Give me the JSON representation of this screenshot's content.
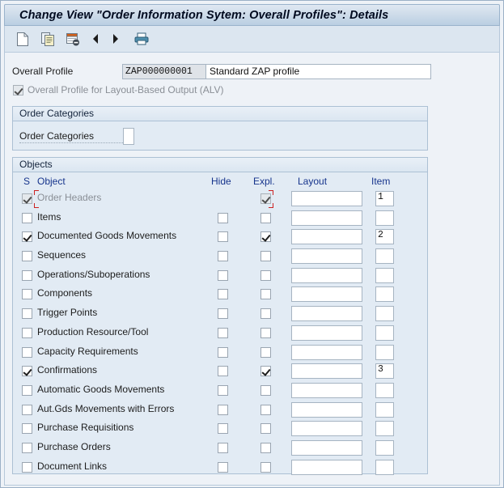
{
  "window": {
    "title": "Change View \"Order Information Sytem: Overall Profiles\": Details"
  },
  "toolbar": {
    "buttons": [
      {
        "name": "new-entries-icon",
        "title": "New Entries"
      },
      {
        "name": "copy-icon",
        "title": "Copy As..."
      },
      {
        "name": "delete-icon",
        "title": "Delete"
      },
      {
        "name": "previous-icon",
        "title": "Previous Entry"
      },
      {
        "name": "next-icon",
        "title": "Next Entry"
      },
      {
        "name": "print-icon",
        "title": "Print"
      }
    ]
  },
  "header": {
    "profile_label": "Overall Profile",
    "profile_id": "ZAP000000001",
    "profile_description": "Standard ZAP profile",
    "alv_label": "Overall Profile for Layout-Based Output (ALV)",
    "alv_checked": true,
    "alv_disabled": true
  },
  "order_categories": {
    "title": "Order Categories",
    "field_label": "Order Categories",
    "field_value": ""
  },
  "objects": {
    "title": "Objects",
    "columns": {
      "s": "S",
      "object": "Object",
      "hide": "Hide",
      "expl": "Expl.",
      "layout": "Layout",
      "item": "Item"
    },
    "rows": [
      {
        "label": "Order Headers",
        "selected": true,
        "dim": true,
        "has_hide": false,
        "hide": false,
        "expl": true,
        "layout": "",
        "item": "1",
        "focused": true
      },
      {
        "label": "Items",
        "selected": false,
        "dim": false,
        "has_hide": true,
        "hide": false,
        "expl": false,
        "layout": "",
        "item": "",
        "focused": false
      },
      {
        "label": "Documented Goods Movements",
        "selected": true,
        "dim": false,
        "has_hide": true,
        "hide": false,
        "expl": true,
        "layout": "",
        "item": "2",
        "focused": false
      },
      {
        "label": "Sequences",
        "selected": false,
        "dim": false,
        "has_hide": true,
        "hide": false,
        "expl": false,
        "layout": "",
        "item": "",
        "focused": false
      },
      {
        "label": "Operations/Suboperations",
        "selected": false,
        "dim": false,
        "has_hide": true,
        "hide": false,
        "expl": false,
        "layout": "",
        "item": "",
        "focused": false
      },
      {
        "label": "Components",
        "selected": false,
        "dim": false,
        "has_hide": true,
        "hide": false,
        "expl": false,
        "layout": "",
        "item": "",
        "focused": false
      },
      {
        "label": "Trigger Points",
        "selected": false,
        "dim": false,
        "has_hide": true,
        "hide": false,
        "expl": false,
        "layout": "",
        "item": "",
        "focused": false
      },
      {
        "label": "Production Resource/Tool",
        "selected": false,
        "dim": false,
        "has_hide": true,
        "hide": false,
        "expl": false,
        "layout": "",
        "item": "",
        "focused": false
      },
      {
        "label": "Capacity Requirements",
        "selected": false,
        "dim": false,
        "has_hide": true,
        "hide": false,
        "expl": false,
        "layout": "",
        "item": "",
        "focused": false
      },
      {
        "label": "Confirmations",
        "selected": true,
        "dim": false,
        "has_hide": true,
        "hide": false,
        "expl": true,
        "layout": "",
        "item": "3",
        "focused": false
      },
      {
        "label": "Automatic Goods Movements",
        "selected": false,
        "dim": false,
        "has_hide": true,
        "hide": false,
        "expl": false,
        "layout": "",
        "item": "",
        "focused": false
      },
      {
        "label": "Aut.Gds Movements with Errors",
        "selected": false,
        "dim": false,
        "has_hide": true,
        "hide": false,
        "expl": false,
        "layout": "",
        "item": "",
        "focused": false
      },
      {
        "label": "Purchase Requisitions",
        "selected": false,
        "dim": false,
        "has_hide": true,
        "hide": false,
        "expl": false,
        "layout": "",
        "item": "",
        "focused": false
      },
      {
        "label": "Purchase Orders",
        "selected": false,
        "dim": false,
        "has_hide": true,
        "hide": false,
        "expl": false,
        "layout": "",
        "item": "",
        "focused": false
      },
      {
        "label": "Document Links",
        "selected": false,
        "dim": false,
        "has_hide": true,
        "hide": false,
        "expl": false,
        "layout": "",
        "item": "",
        "focused": false
      }
    ]
  },
  "colors": {
    "title_text": "#000a1f",
    "column_header_text": "#16348c",
    "panel_bg": "#e2ebf4",
    "content_bg": "#eef2f7",
    "focus_marker": "#cc2222"
  }
}
